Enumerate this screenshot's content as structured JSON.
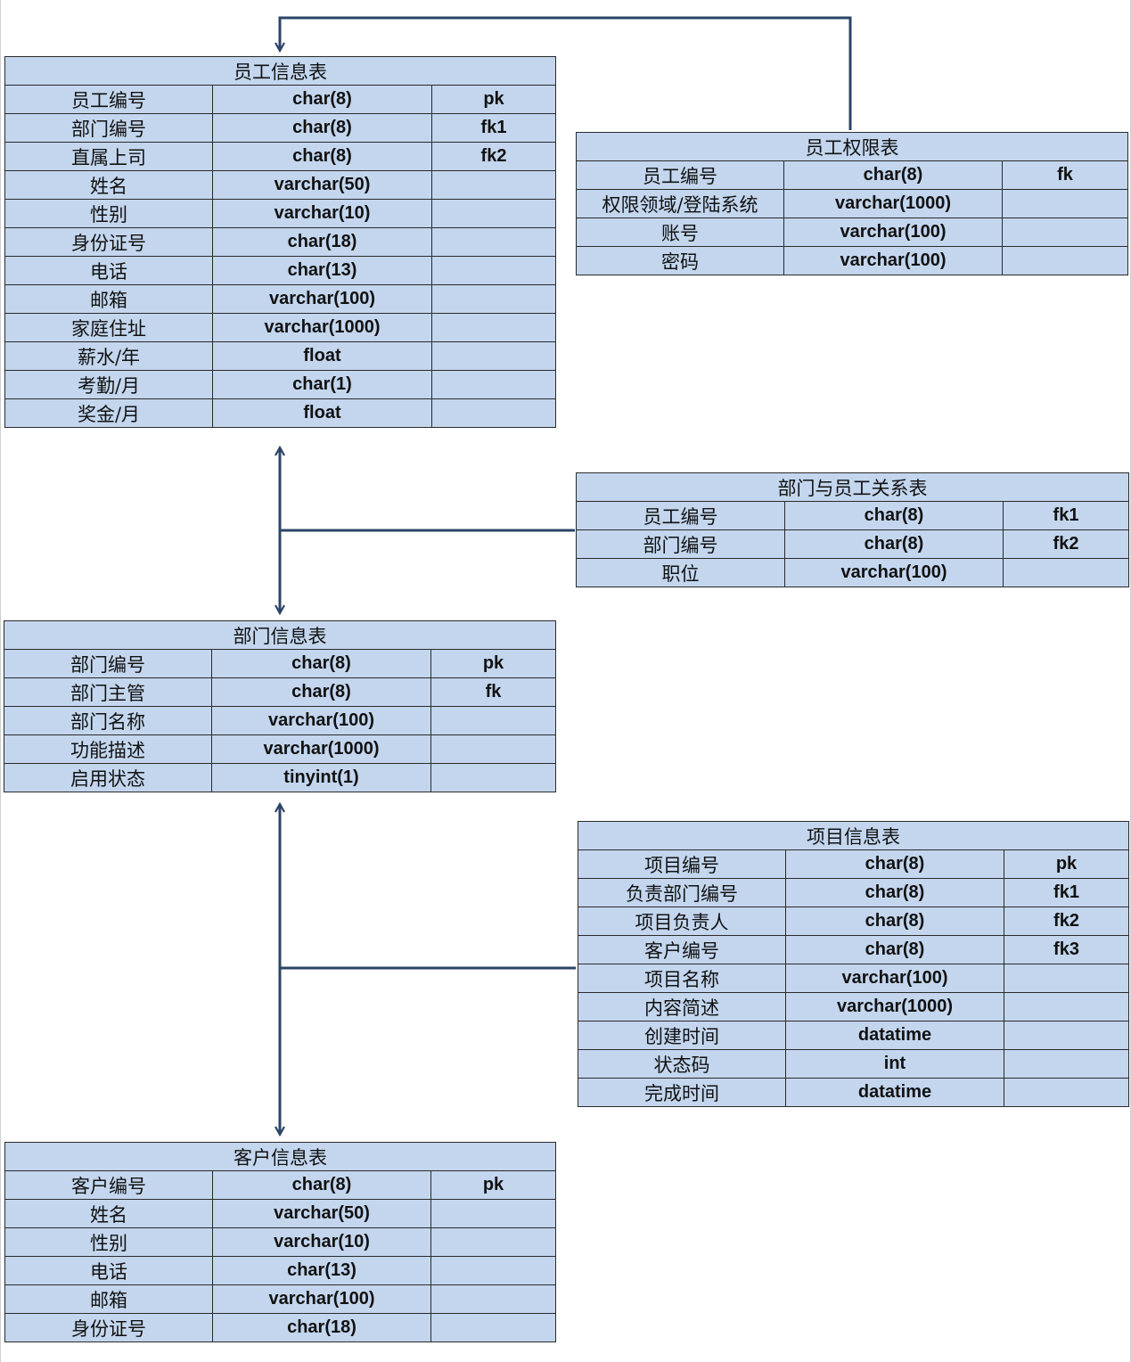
{
  "tables": {
    "employee": {
      "title": "员工信息表",
      "rows": [
        {
          "name": "员工编号",
          "type": "char(8)",
          "key": "pk"
        },
        {
          "name": "部门编号",
          "type": "char(8)",
          "key": "fk1"
        },
        {
          "name": "直属上司",
          "type": "char(8)",
          "key": "fk2"
        },
        {
          "name": "姓名",
          "type": "varchar(50)",
          "key": ""
        },
        {
          "name": "性别",
          "type": "varchar(10)",
          "key": ""
        },
        {
          "name": "身份证号",
          "type": "char(18)",
          "key": ""
        },
        {
          "name": "电话",
          "type": "char(13)",
          "key": ""
        },
        {
          "name": "邮箱",
          "type": "varchar(100)",
          "key": ""
        },
        {
          "name": "家庭住址",
          "type": "varchar(1000)",
          "key": ""
        },
        {
          "name": "薪水/年",
          "type": "float",
          "key": ""
        },
        {
          "name": "考勤/月",
          "type": "char(1)",
          "key": ""
        },
        {
          "name": "奖金/月",
          "type": "float",
          "key": ""
        }
      ]
    },
    "permission": {
      "title": "员工权限表",
      "rows": [
        {
          "name": "员工编号",
          "type": "char(8)",
          "key": "fk"
        },
        {
          "name": "权限领域/登陆系统",
          "type": "varchar(1000)",
          "key": ""
        },
        {
          "name": "账号",
          "type": "varchar(100)",
          "key": ""
        },
        {
          "name": "密码",
          "type": "varchar(100)",
          "key": ""
        }
      ]
    },
    "dept_emp": {
      "title": "部门与员工关系表",
      "rows": [
        {
          "name": "员工编号",
          "type": "char(8)",
          "key": "fk1"
        },
        {
          "name": "部门编号",
          "type": "char(8)",
          "key": "fk2"
        },
        {
          "name": "职位",
          "type": "varchar(100)",
          "key": ""
        }
      ]
    },
    "department": {
      "title": "部门信息表",
      "rows": [
        {
          "name": "部门编号",
          "type": "char(8)",
          "key": "pk"
        },
        {
          "name": "部门主管",
          "type": "char(8)",
          "key": "fk"
        },
        {
          "name": "部门名称",
          "type": "varchar(100)",
          "key": ""
        },
        {
          "name": "功能描述",
          "type": "varchar(1000)",
          "key": ""
        },
        {
          "name": "启用状态",
          "type": "tinyint(1)",
          "key": ""
        }
      ]
    },
    "project": {
      "title": "项目信息表",
      "rows": [
        {
          "name": "项目编号",
          "type": "char(8)",
          "key": "pk"
        },
        {
          "name": "负责部门编号",
          "type": "char(8)",
          "key": "fk1"
        },
        {
          "name": "项目负责人",
          "type": "char(8)",
          "key": "fk2"
        },
        {
          "name": "客户编号",
          "type": "char(8)",
          "key": "fk3"
        },
        {
          "name": "项目名称",
          "type": "varchar(100)",
          "key": ""
        },
        {
          "name": "内容简述",
          "type": "varchar(1000)",
          "key": ""
        },
        {
          "name": "创建时间",
          "type": "datatime",
          "key": ""
        },
        {
          "name": "状态码",
          "type": "int",
          "key": ""
        },
        {
          "name": "完成时间",
          "type": "datatime",
          "key": ""
        }
      ]
    },
    "customer": {
      "title": "客户信息表",
      "rows": [
        {
          "name": "客户编号",
          "type": "char(8)",
          "key": "pk"
        },
        {
          "name": "姓名",
          "type": "varchar(50)",
          "key": ""
        },
        {
          "name": "性别",
          "type": "varchar(10)",
          "key": ""
        },
        {
          "name": "电话",
          "type": "char(13)",
          "key": ""
        },
        {
          "name": "邮箱",
          "type": "varchar(100)",
          "key": ""
        },
        {
          "name": "身份证号",
          "type": "char(18)",
          "key": ""
        }
      ]
    }
  },
  "colors": {
    "table_fill": "#c3d6ee",
    "border": "#2a2a2a",
    "connector": "#2c4468"
  }
}
